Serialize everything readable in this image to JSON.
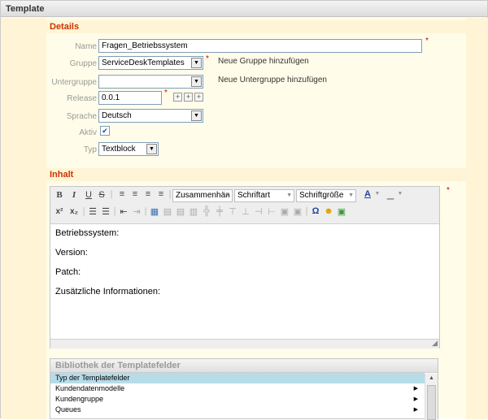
{
  "panel": {
    "title": "Template"
  },
  "details": {
    "title": "Details",
    "name": {
      "label": "Name",
      "value": "Fragen_Betriebssystem"
    },
    "gruppe": {
      "label": "Gruppe",
      "value": "ServiceDeskTemplates",
      "add_link": "Neue Gruppe hinzufügen"
    },
    "untergruppe": {
      "label": "Untergruppe",
      "value": "",
      "add_link": "Neue Untergruppe hinzufügen"
    },
    "release": {
      "label": "Release",
      "value": "0.0.1"
    },
    "sprache": {
      "label": "Sprache",
      "value": "Deutsch"
    },
    "aktiv": {
      "label": "Aktiv",
      "checked": true
    },
    "typ": {
      "label": "Typ",
      "value": "Textblock"
    },
    "required_marker": "*"
  },
  "inhalt": {
    "title": "Inhalt",
    "toolbar": {
      "bold": "B",
      "italic": "I",
      "underline": "U",
      "strike": "S",
      "format_combo": "Zusammenhän",
      "font_combo": "Schriftart",
      "size_combo": "Schriftgröße",
      "superscript": "x²",
      "subscript": "x₂",
      "omega": "Ω"
    },
    "content_lines": [
      "Betriebssystem:",
      "Version:",
      "Patch:",
      "Zusätzliche Informationen:"
    ]
  },
  "library": {
    "title": "Bibliothek der Templatefelder",
    "rows": [
      {
        "label": "Typ der Templatefelder",
        "selected": true,
        "has_submenu": false
      },
      {
        "label": "Kundendatenmodelle",
        "selected": false,
        "has_submenu": true
      },
      {
        "label": "Kundengruppe",
        "selected": false,
        "has_submenu": true
      },
      {
        "label": "Queues",
        "selected": false,
        "has_submenu": true
      }
    ]
  },
  "colors": {
    "section_title": "#cc3300",
    "required": "#cc0000",
    "selected_row": "#b6dce8",
    "panel_bg": "#fffde9"
  }
}
